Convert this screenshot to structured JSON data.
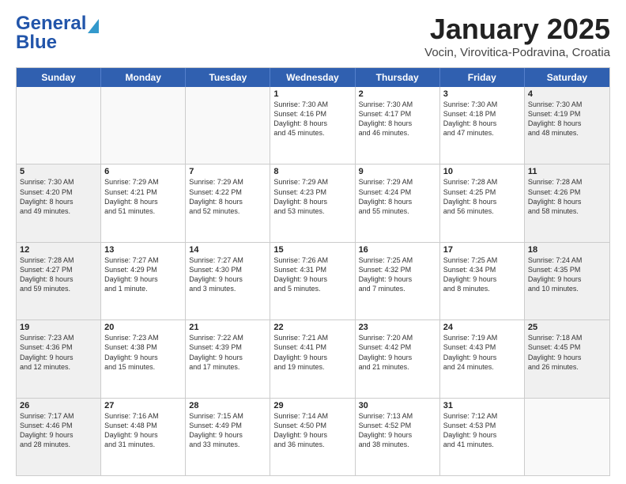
{
  "header": {
    "logo_line1": "General",
    "logo_line2": "Blue",
    "title": "January 2025",
    "location": "Vocin, Virovitica-Podravina, Croatia"
  },
  "weekdays": [
    "Sunday",
    "Monday",
    "Tuesday",
    "Wednesday",
    "Thursday",
    "Friday",
    "Saturday"
  ],
  "rows": [
    [
      {
        "day": "",
        "info": ""
      },
      {
        "day": "",
        "info": ""
      },
      {
        "day": "",
        "info": ""
      },
      {
        "day": "1",
        "info": "Sunrise: 7:30 AM\nSunset: 4:16 PM\nDaylight: 8 hours\nand 45 minutes."
      },
      {
        "day": "2",
        "info": "Sunrise: 7:30 AM\nSunset: 4:17 PM\nDaylight: 8 hours\nand 46 minutes."
      },
      {
        "day": "3",
        "info": "Sunrise: 7:30 AM\nSunset: 4:18 PM\nDaylight: 8 hours\nand 47 minutes."
      },
      {
        "day": "4",
        "info": "Sunrise: 7:30 AM\nSunset: 4:19 PM\nDaylight: 8 hours\nand 48 minutes."
      }
    ],
    [
      {
        "day": "5",
        "info": "Sunrise: 7:30 AM\nSunset: 4:20 PM\nDaylight: 8 hours\nand 49 minutes."
      },
      {
        "day": "6",
        "info": "Sunrise: 7:29 AM\nSunset: 4:21 PM\nDaylight: 8 hours\nand 51 minutes."
      },
      {
        "day": "7",
        "info": "Sunrise: 7:29 AM\nSunset: 4:22 PM\nDaylight: 8 hours\nand 52 minutes."
      },
      {
        "day": "8",
        "info": "Sunrise: 7:29 AM\nSunset: 4:23 PM\nDaylight: 8 hours\nand 53 minutes."
      },
      {
        "day": "9",
        "info": "Sunrise: 7:29 AM\nSunset: 4:24 PM\nDaylight: 8 hours\nand 55 minutes."
      },
      {
        "day": "10",
        "info": "Sunrise: 7:28 AM\nSunset: 4:25 PM\nDaylight: 8 hours\nand 56 minutes."
      },
      {
        "day": "11",
        "info": "Sunrise: 7:28 AM\nSunset: 4:26 PM\nDaylight: 8 hours\nand 58 minutes."
      }
    ],
    [
      {
        "day": "12",
        "info": "Sunrise: 7:28 AM\nSunset: 4:27 PM\nDaylight: 8 hours\nand 59 minutes."
      },
      {
        "day": "13",
        "info": "Sunrise: 7:27 AM\nSunset: 4:29 PM\nDaylight: 9 hours\nand 1 minute."
      },
      {
        "day": "14",
        "info": "Sunrise: 7:27 AM\nSunset: 4:30 PM\nDaylight: 9 hours\nand 3 minutes."
      },
      {
        "day": "15",
        "info": "Sunrise: 7:26 AM\nSunset: 4:31 PM\nDaylight: 9 hours\nand 5 minutes."
      },
      {
        "day": "16",
        "info": "Sunrise: 7:25 AM\nSunset: 4:32 PM\nDaylight: 9 hours\nand 7 minutes."
      },
      {
        "day": "17",
        "info": "Sunrise: 7:25 AM\nSunset: 4:34 PM\nDaylight: 9 hours\nand 8 minutes."
      },
      {
        "day": "18",
        "info": "Sunrise: 7:24 AM\nSunset: 4:35 PM\nDaylight: 9 hours\nand 10 minutes."
      }
    ],
    [
      {
        "day": "19",
        "info": "Sunrise: 7:23 AM\nSunset: 4:36 PM\nDaylight: 9 hours\nand 12 minutes."
      },
      {
        "day": "20",
        "info": "Sunrise: 7:23 AM\nSunset: 4:38 PM\nDaylight: 9 hours\nand 15 minutes."
      },
      {
        "day": "21",
        "info": "Sunrise: 7:22 AM\nSunset: 4:39 PM\nDaylight: 9 hours\nand 17 minutes."
      },
      {
        "day": "22",
        "info": "Sunrise: 7:21 AM\nSunset: 4:41 PM\nDaylight: 9 hours\nand 19 minutes."
      },
      {
        "day": "23",
        "info": "Sunrise: 7:20 AM\nSunset: 4:42 PM\nDaylight: 9 hours\nand 21 minutes."
      },
      {
        "day": "24",
        "info": "Sunrise: 7:19 AM\nSunset: 4:43 PM\nDaylight: 9 hours\nand 24 minutes."
      },
      {
        "day": "25",
        "info": "Sunrise: 7:18 AM\nSunset: 4:45 PM\nDaylight: 9 hours\nand 26 minutes."
      }
    ],
    [
      {
        "day": "26",
        "info": "Sunrise: 7:17 AM\nSunset: 4:46 PM\nDaylight: 9 hours\nand 28 minutes."
      },
      {
        "day": "27",
        "info": "Sunrise: 7:16 AM\nSunset: 4:48 PM\nDaylight: 9 hours\nand 31 minutes."
      },
      {
        "day": "28",
        "info": "Sunrise: 7:15 AM\nSunset: 4:49 PM\nDaylight: 9 hours\nand 33 minutes."
      },
      {
        "day": "29",
        "info": "Sunrise: 7:14 AM\nSunset: 4:50 PM\nDaylight: 9 hours\nand 36 minutes."
      },
      {
        "day": "30",
        "info": "Sunrise: 7:13 AM\nSunset: 4:52 PM\nDaylight: 9 hours\nand 38 minutes."
      },
      {
        "day": "31",
        "info": "Sunrise: 7:12 AM\nSunset: 4:53 PM\nDaylight: 9 hours\nand 41 minutes."
      },
      {
        "day": "",
        "info": ""
      }
    ]
  ]
}
